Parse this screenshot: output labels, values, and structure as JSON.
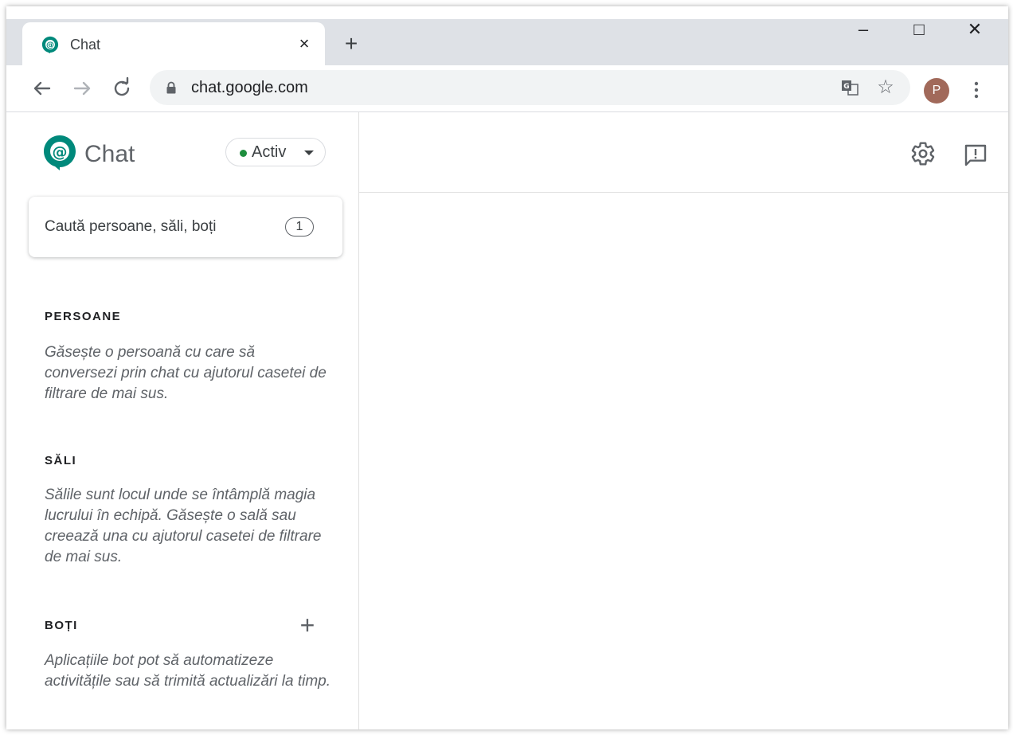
{
  "browser": {
    "tab_title": "Chat",
    "tab_close": "×",
    "new_tab": "+",
    "url": "chat.google.com",
    "profile_initial": "P",
    "window_minimize": "–",
    "window_maximize": "□",
    "window_close": "✕"
  },
  "app": {
    "name": "Chat",
    "status": "Activ",
    "status_color": "#1e8e3e",
    "brand_color": "#00897b",
    "search_placeholder": "Caută persoane, săli, boți",
    "search_shortcut": "1"
  },
  "sections": {
    "people": {
      "title": "PERSOANE",
      "description": "Găsește o persoană cu care să conversezi prin chat cu ajutorul casetei de filtrare de mai sus."
    },
    "rooms": {
      "title": "SĂLI",
      "description": "Sălile sunt locul unde se întâmplă magia lucrului în echipă. Găsește o sală sau creează una cu ajutorul casetei de filtrare de mai sus."
    },
    "bots": {
      "title": "BOȚI",
      "description": "Aplicațiile bot pot să automatizeze activitățile sau să trimită actualizări la timp.",
      "add_label": "+"
    }
  },
  "icons": [
    "chat-logo-icon",
    "lock-icon",
    "translate-icon",
    "star-icon",
    "settings-icon",
    "feedback-icon",
    "back-arrow-icon",
    "forward-arrow-icon",
    "reload-icon",
    "more-vert-icon"
  ]
}
